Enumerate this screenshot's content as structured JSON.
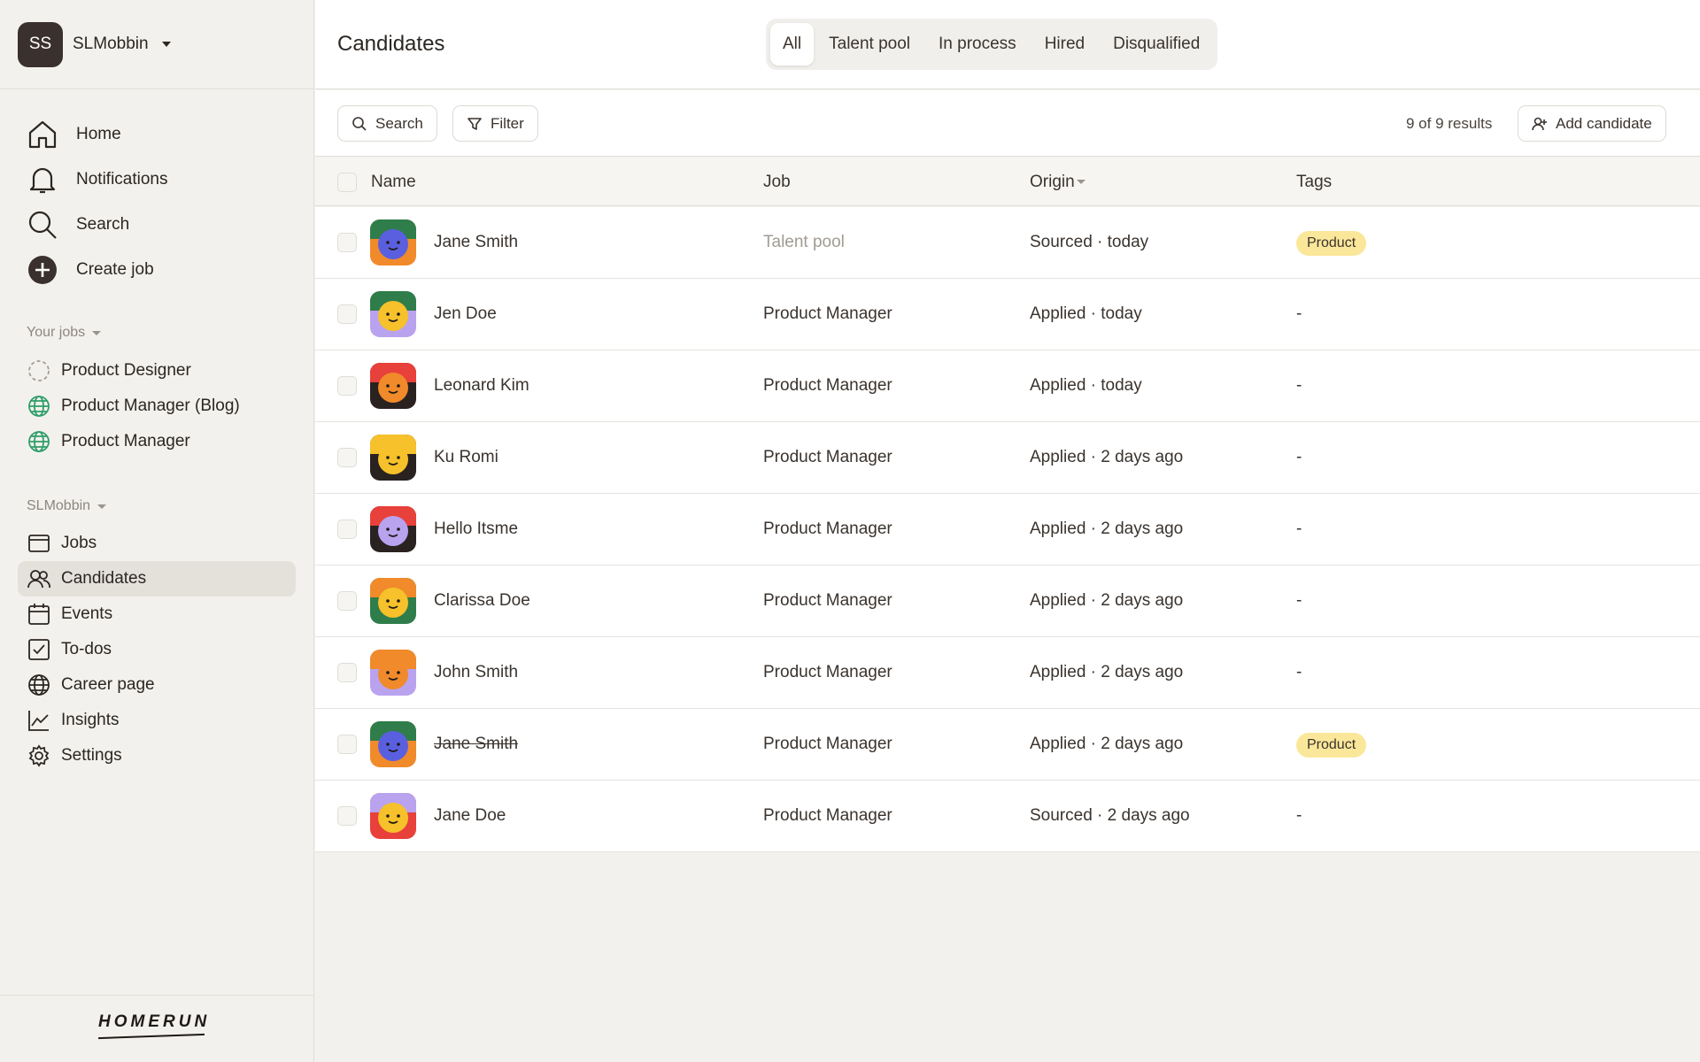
{
  "workspace": {
    "initials": "SS",
    "name": "SLMobbin"
  },
  "main_nav": [
    {
      "label": "Home",
      "icon": "home-icon"
    },
    {
      "label": "Notifications",
      "icon": "bell-icon"
    },
    {
      "label": "Search",
      "icon": "search-icon"
    },
    {
      "label": "Create job",
      "icon": "plus-circle-icon"
    }
  ],
  "your_jobs": {
    "label": "Your jobs",
    "items": [
      {
        "label": "Product Designer",
        "icon": "draft-circle-icon"
      },
      {
        "label": "Product Manager (Blog)",
        "icon": "globe-icon"
      },
      {
        "label": "Product Manager",
        "icon": "globe-icon"
      }
    ]
  },
  "company": {
    "label": "SLMobbin",
    "items": [
      {
        "label": "Jobs",
        "icon": "jobs-icon"
      },
      {
        "label": "Candidates",
        "icon": "people-icon",
        "active": true
      },
      {
        "label": "Events",
        "icon": "calendar-icon"
      },
      {
        "label": "To-dos",
        "icon": "checkbox-icon"
      },
      {
        "label": "Career page",
        "icon": "globe-icon"
      },
      {
        "label": "Insights",
        "icon": "chart-icon"
      },
      {
        "label": "Settings",
        "icon": "gear-icon"
      }
    ]
  },
  "logo": "HOMERUN",
  "header": {
    "title": "Candidates",
    "tabs": [
      "All",
      "Talent pool",
      "In process",
      "Hired",
      "Disqualified"
    ],
    "active_tab": "All"
  },
  "toolbar": {
    "search_label": "Search",
    "filter_label": "Filter",
    "results": "9 of 9 results",
    "add_label": "Add candidate"
  },
  "table": {
    "columns": {
      "name": "Name",
      "job": "Job",
      "origin": "Origin",
      "tags": "Tags"
    },
    "rows": [
      {
        "name": "Jane Smith",
        "job": "Talent pool",
        "origin": "Sourced · today",
        "tag": "Product",
        "avatar": "blue-green",
        "job_muted": true
      },
      {
        "name": "Jen Doe",
        "job": "Product Manager",
        "origin": "Applied · today",
        "tag": "-",
        "avatar": "yellow-green"
      },
      {
        "name": "Leonard Kim",
        "job": "Product Manager",
        "origin": "Applied · today",
        "tag": "-",
        "avatar": "orange-red"
      },
      {
        "name": "Ku Romi",
        "job": "Product Manager",
        "origin": "Applied · 2 days ago",
        "tag": "-",
        "avatar": "yellow-black"
      },
      {
        "name": "Hello Itsme",
        "job": "Product Manager",
        "origin": "Applied · 2 days ago",
        "tag": "-",
        "avatar": "purple-red"
      },
      {
        "name": "Clarissa Doe",
        "job": "Product Manager",
        "origin": "Applied · 2 days ago",
        "tag": "-",
        "avatar": "yellow-orange"
      },
      {
        "name": "John Smith",
        "job": "Product Manager",
        "origin": "Applied · 2 days ago",
        "tag": "-",
        "avatar": "orange-purple"
      },
      {
        "name": "Jane Smith",
        "job": "Product Manager",
        "origin": "Applied · 2 days ago",
        "tag": "Product",
        "avatar": "blue-green",
        "strike": true
      },
      {
        "name": "Jane Doe",
        "job": "Product Manager",
        "origin": "Sourced · 2 days ago",
        "tag": "-",
        "avatar": "yellow-purple"
      }
    ]
  },
  "colors": {
    "tag_bg": "#fbe79a",
    "globe_green": "#2f9e6a",
    "sidebar_bg": "#f3f1ed",
    "avatar_bg": "#3a302d"
  }
}
